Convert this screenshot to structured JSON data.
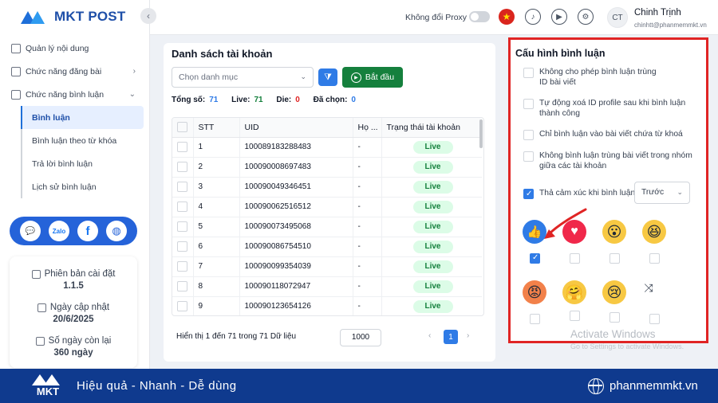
{
  "brand": {
    "name": "MKT POST"
  },
  "sidebar": {
    "items": [
      {
        "label": "Quản lý nội dung",
        "icon": "content-icon"
      },
      {
        "label": "Chức năng đăng bài",
        "icon": "post-icon"
      },
      {
        "label": "Chức năng bình luận",
        "icon": "comment-icon"
      }
    ],
    "sub_items": [
      {
        "label": "Bình luận",
        "active": true
      },
      {
        "label": "Bình luận theo từ khóa",
        "active": false
      },
      {
        "label": "Trả lời bình luận",
        "active": false
      },
      {
        "label": "Lịch sử bình luận",
        "active": false
      }
    ],
    "social": {
      "zalo": "Zalo",
      "facebook": "f"
    },
    "info": {
      "version_label": "Phiên bản cài đặt",
      "version": "1.1.5",
      "update_label": "Ngày cập nhật",
      "update_date": "20/6/2025",
      "days_label": "Số ngày còn lại",
      "days_left": "360 ngày"
    }
  },
  "topbar": {
    "proxy_label": "Không đổi Proxy",
    "avatar_initials": "CT",
    "user_name": "Chinh Trịnh",
    "user_email": "chinhtt@phanmemmkt.vn"
  },
  "accounts": {
    "title": "Danh sách tài khoản",
    "category_placeholder": "Chọn danh mục",
    "start_label": "Bắt đầu",
    "stats": {
      "total_label": "Tổng số:",
      "total": "71",
      "live_label": "Live:",
      "live": "71",
      "die_label": "Die:",
      "die": "0",
      "selected_label": "Đã chọn:",
      "selected": "0"
    },
    "columns": {
      "stt": "STT",
      "uid": "UID",
      "name": "Họ ...",
      "status": "Trạng thái tài khoản"
    },
    "rows": [
      {
        "stt": "1",
        "uid": "100089183288483",
        "name": "-",
        "status": "Live"
      },
      {
        "stt": "2",
        "uid": "100090008697483",
        "name": "-",
        "status": "Live"
      },
      {
        "stt": "3",
        "uid": "100090049346451",
        "name": "-",
        "status": "Live"
      },
      {
        "stt": "4",
        "uid": "100090062516512",
        "name": "-",
        "status": "Live"
      },
      {
        "stt": "5",
        "uid": "100090073495068",
        "name": "-",
        "status": "Live"
      },
      {
        "stt": "6",
        "uid": "100090086754510",
        "name": "-",
        "status": "Live"
      },
      {
        "stt": "7",
        "uid": "100090099354039",
        "name": "-",
        "status": "Live"
      },
      {
        "stt": "8",
        "uid": "100090118072947",
        "name": "-",
        "status": "Live"
      },
      {
        "stt": "9",
        "uid": "100090123654126",
        "name": "-",
        "status": "Live"
      }
    ],
    "footer_text": "Hiển thị 1 đến 71 trong 71 Dữ liệu",
    "page_size": "1000",
    "current_page": "1"
  },
  "config": {
    "title": "Cấu hình bình luận",
    "options": [
      {
        "label_l1": "Không cho phép bình luận trùng",
        "label_l2": "ID bài viết",
        "checked": false
      },
      {
        "label_l1": "Tự động xoá ID profile sau khi bình luận",
        "label_l2": "thành công",
        "checked": false
      },
      {
        "label_l1": "Chỉ bình luận vào bài viết chứa từ khoá",
        "label_l2": "",
        "checked": false
      },
      {
        "label_l1": "Không bình luận trùng bài viết trong nhóm",
        "label_l2": "giữa các tài khoản",
        "checked": false
      }
    ],
    "reaction_option": {
      "label": "Thả cảm xúc khi bình luận",
      "checked": true,
      "timing": "Trước"
    },
    "reactions": [
      {
        "icon": "like-icon",
        "checked": true
      },
      {
        "icon": "love-icon",
        "checked": false
      },
      {
        "icon": "wow-icon",
        "checked": false
      },
      {
        "icon": "haha-icon",
        "checked": false
      },
      {
        "icon": "angry-icon",
        "checked": false
      },
      {
        "icon": "care-icon",
        "checked": false
      },
      {
        "icon": "sad-icon",
        "checked": false
      },
      {
        "icon": "random-icon",
        "checked": false
      }
    ]
  },
  "watermark": {
    "line1": "Activate Windows",
    "line2": "Go to Settings to activate Windows."
  },
  "banner": {
    "logo": "MKT",
    "slogan": "Hiệu quả - Nhanh - Dễ dùng",
    "website": "phanmemmkt.vn"
  },
  "colors": {
    "primary": "#2f7be6",
    "success": "#15803d",
    "highlight": "#e02424",
    "banner": "#0f3a8e"
  }
}
